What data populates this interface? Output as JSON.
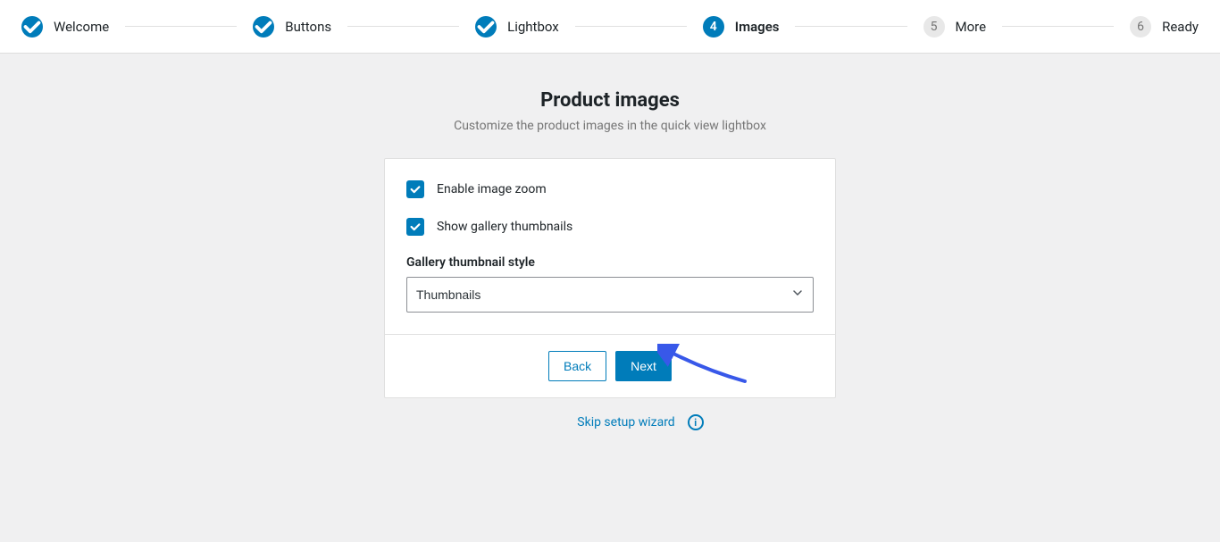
{
  "stepper": {
    "steps": [
      {
        "label": "Welcome",
        "state": "done"
      },
      {
        "label": "Buttons",
        "state": "done"
      },
      {
        "label": "Lightbox",
        "state": "done"
      },
      {
        "label": "Images",
        "state": "current",
        "number": "4"
      },
      {
        "label": "More",
        "state": "pending",
        "number": "5"
      },
      {
        "label": "Ready",
        "state": "pending",
        "number": "6"
      }
    ]
  },
  "page": {
    "title": "Product images",
    "subtitle": "Customize the product images in the quick view lightbox"
  },
  "options": {
    "enable_zoom": {
      "label": "Enable image zoom",
      "checked": true
    },
    "show_thumbs": {
      "label": "Show gallery thumbnails",
      "checked": true
    }
  },
  "gallery_style": {
    "label": "Gallery thumbnail style",
    "selected": "Thumbnails"
  },
  "buttons": {
    "back": "Back",
    "next": "Next"
  },
  "skip": {
    "label": "Skip setup wizard"
  }
}
